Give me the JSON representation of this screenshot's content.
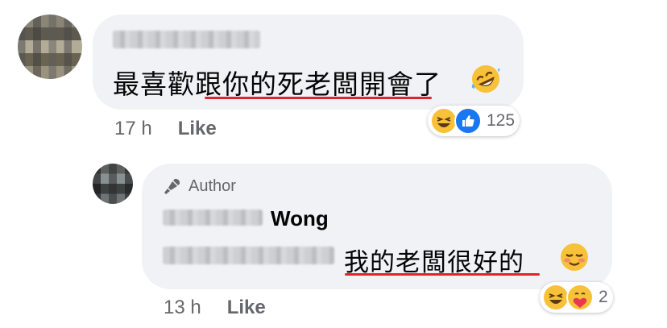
{
  "comment1": {
    "text": "最喜歡跟你的死老闆開會了",
    "time": "17 h",
    "like_label": "Like",
    "reaction_count": "125",
    "reactions": [
      "laugh-icon",
      "like-icon"
    ]
  },
  "reply1": {
    "author_badge": "Author",
    "name_visible": "Wong",
    "text": "我的老闆很好的",
    "time": "13 h",
    "like_label": "Like",
    "reaction_count": "2",
    "reactions": [
      "laugh-icon",
      "care-icon"
    ]
  },
  "colors": {
    "bubble": "#f0f2f5",
    "underline": "#e0242b",
    "like_blue": "#1877f2",
    "meta_text": "#65676b"
  }
}
